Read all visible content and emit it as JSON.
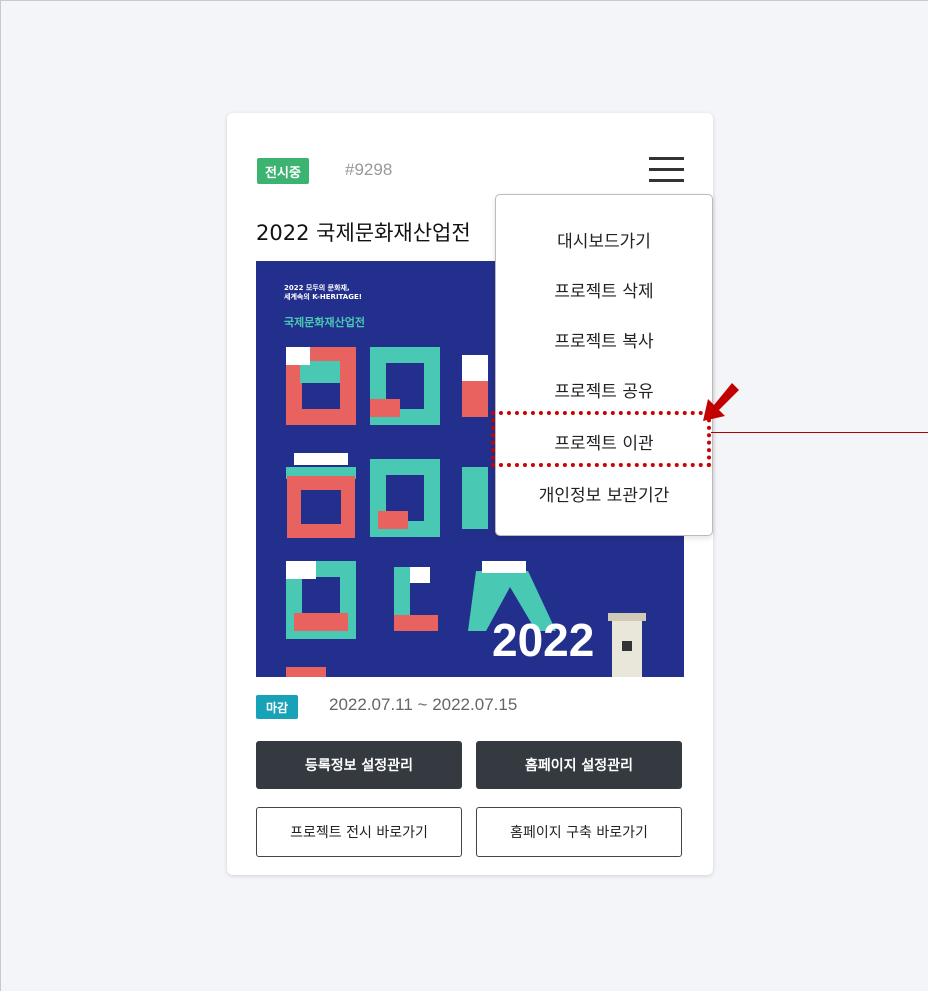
{
  "card": {
    "status_badge": "전시중",
    "project_id": "#9298",
    "title": "2022 국제문화재산업전",
    "poster": {
      "subtitle_line1": "2022 모두의 문화재,",
      "subtitle_line2": "세계속의 K-HERITAGE!",
      "main_title": "국제문화재산업전",
      "year": "2022"
    },
    "deadline_badge": "마감",
    "date_range": "2022.07.11 ~ 2022.07.15",
    "buttons": {
      "registration_settings": "등록정보 설정관리",
      "homepage_settings": "홈페이지 설정관리",
      "go_exhibition": "프로젝트 전시 바로가기",
      "go_homepage_build": "홈페이지 구축 바로가기"
    }
  },
  "dropdown": {
    "items": [
      {
        "label": "대시보드가기"
      },
      {
        "label": "프로젝트 삭제"
      },
      {
        "label": "프로젝트 복사"
      },
      {
        "label": "프로젝트 공유"
      },
      {
        "label": "프로젝트 이관"
      },
      {
        "label": "개인정보 보관기간"
      }
    ]
  },
  "colors": {
    "status_green": "#3cb371",
    "deadline_teal": "#17a2b8",
    "dark_button": "#343a40",
    "poster_navy": "#232f8c",
    "poster_mint": "#49c9b4",
    "poster_coral": "#e8625f",
    "annotation_red": "#cc0000"
  },
  "icons": [
    "hamburger-menu-icon",
    "arrow-pointer-icon"
  ]
}
